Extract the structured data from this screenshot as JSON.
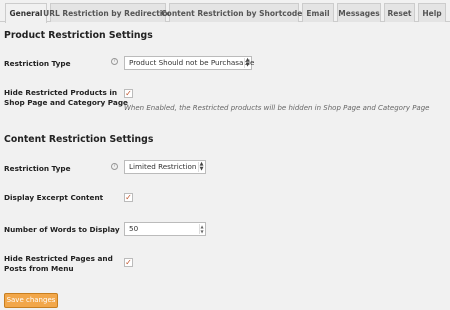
{
  "tabs": [
    {
      "label": "General",
      "active": true
    },
    {
      "label": "URL Restriction by Redirection",
      "active": false
    },
    {
      "label": "Content Restriction by Shortcodes",
      "active": false
    },
    {
      "label": "Email",
      "active": false
    },
    {
      "label": "Messages",
      "active": false
    },
    {
      "label": "Reset",
      "active": false
    },
    {
      "label": "Help",
      "active": false
    }
  ],
  "product_section": {
    "title": "Product Restriction Settings",
    "restriction_type": {
      "label": "Restriction Type",
      "value": "Product Should not be Purchasable"
    },
    "hide_products": {
      "label_line1": "Hide Restricted Products in",
      "label_line2": "Shop Page and Category Page",
      "checked": true,
      "hint": "When Enabled, the Restricted products will be hidden in Shop Page and Category Page"
    }
  },
  "content_section": {
    "title": "Content Restriction Settings",
    "restriction_type": {
      "label": "Restriction Type",
      "value": "Limited Restriction"
    },
    "display_excerpt": {
      "label": "Display Excerpt Content",
      "checked": true
    },
    "words": {
      "label": "Number of Words to Display",
      "value": "50"
    },
    "hide_pages": {
      "label_line1": "Hide Restricted Pages and",
      "label_line2": "Posts from Menu",
      "checked": true
    }
  },
  "save_label": "Save changes",
  "colors": {
    "checkmark": "#c0562f",
    "save_button": "#f2a74a"
  }
}
